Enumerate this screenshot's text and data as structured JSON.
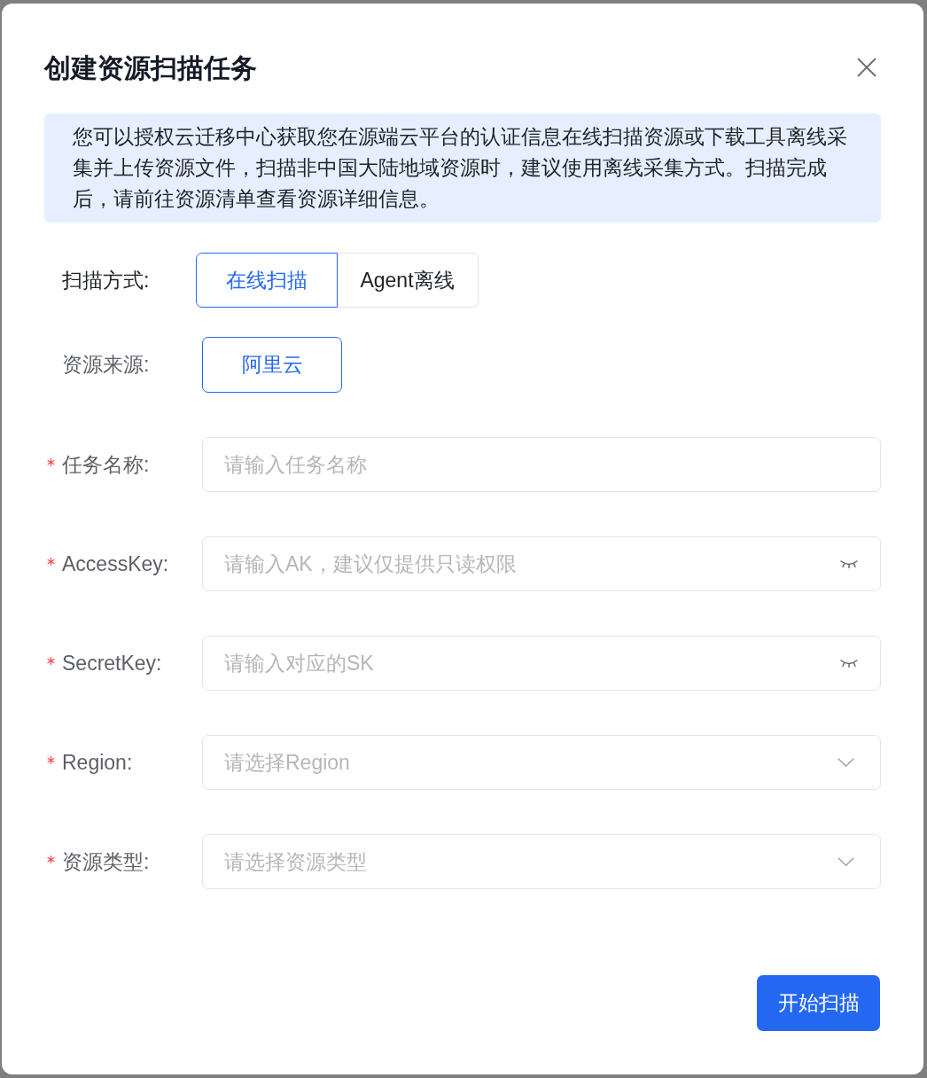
{
  "dialog": {
    "title": "创建资源扫描任务"
  },
  "notice": "您可以授权云迁移中心获取您在源端云平台的认证信息在线扫描资源或下载工具离线采集并上传资源文件，扫描非中国大陆地域资源时，建议使用离线采集方式。扫描完成后，请前往资源清单查看资源详细信息。",
  "scan_method": {
    "label": "扫描方式:",
    "options": [
      {
        "label": "在线扫描",
        "selected": true
      },
      {
        "label": "Agent离线",
        "selected": false
      }
    ]
  },
  "source": {
    "label": "资源来源:",
    "options": [
      {
        "label": "阿里云",
        "selected": true
      }
    ]
  },
  "fields": [
    {
      "label": "任务名称:",
      "required": true,
      "kind": "text",
      "placeholder": "请输入任务名称"
    },
    {
      "label": "AccessKey:",
      "required": true,
      "kind": "password",
      "placeholder": "请输入AK，建议仅提供只读权限"
    },
    {
      "label": "SecretKey:",
      "required": true,
      "kind": "password",
      "placeholder": "请输入对应的SK"
    },
    {
      "label": "Region:",
      "required": true,
      "kind": "select",
      "placeholder": "请选择Region"
    },
    {
      "label": "资源类型:",
      "required": true,
      "kind": "select",
      "placeholder": "请选择资源类型"
    }
  ],
  "submit": "开始扫描"
}
